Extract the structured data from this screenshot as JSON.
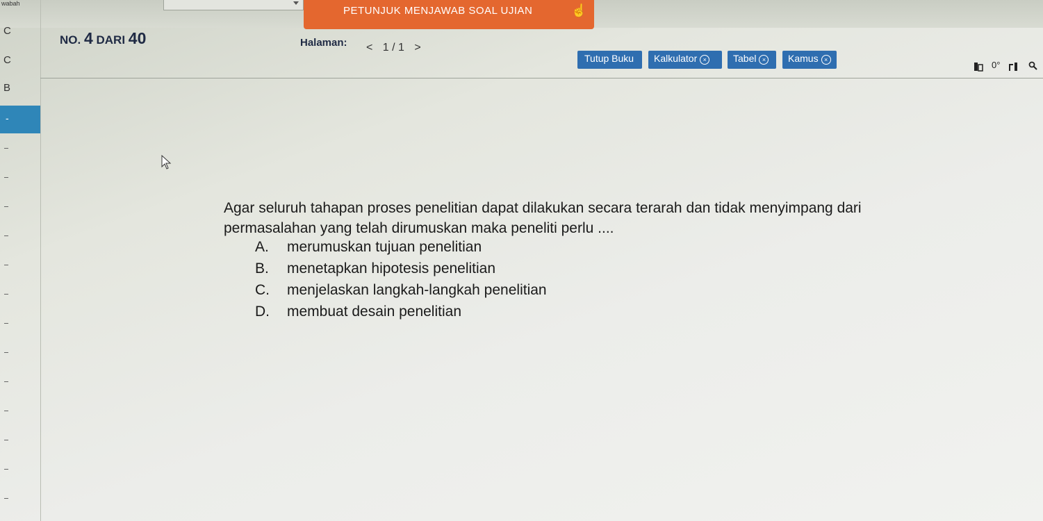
{
  "top": {
    "left_label": "wabah",
    "petunjuk_label": "PETUNJUK MENJAWAB SOAL UJIAN"
  },
  "sidebar": {
    "items": [
      "C",
      "C",
      "B"
    ],
    "active_label": "-"
  },
  "header": {
    "no_prefix": "NO.",
    "current": "4",
    "dari": "DARI",
    "total": "40",
    "halaman_label": "Halaman:",
    "prev": "<",
    "page": "1 / 1",
    "next": ">"
  },
  "toolbar": {
    "tutup_buku": "Tutup Buku",
    "kalkulator": "Kalkulator",
    "tabel": "Tabel",
    "kamus": "Kamus",
    "close_glyph": "×",
    "zoom_label": "0°"
  },
  "question": {
    "text": "Agar seluruh tahapan proses penelitian dapat dilakukan secara terarah dan tidak menyimpang dari permasalahan yang telah dirumuskan maka peneliti perlu ....",
    "options": [
      {
        "letter": "A.",
        "text": "merumuskan tujuan penelitian"
      },
      {
        "letter": "B.",
        "text": "menetapkan hipotesis penelitian"
      },
      {
        "letter": "C.",
        "text": "menjelaskan langkah-langkah penelitian"
      },
      {
        "letter": "D.",
        "text": "membuat desain penelitian"
      }
    ]
  },
  "colors": {
    "accent_orange": "#e4672f",
    "button_blue": "#2f6eb0",
    "sidebar_active": "#2f86b8"
  }
}
